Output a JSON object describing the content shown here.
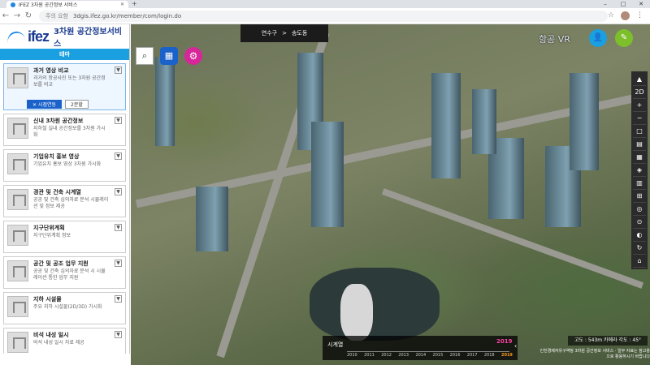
{
  "browser": {
    "tab_title": "IFEZ 3차원 공간정보 서비스",
    "url_security": "주의 요함",
    "url": "3dgis.ifez.go.kr/member/com/login.do"
  },
  "sidebar": {
    "logo": "ifez",
    "logo_sub": "3차원 공간정보서비스",
    "theme_label": "테마",
    "items": [
      {
        "title": "과거 영상 비교",
        "desc": "과거의 항공사진 또는 3차원 공간정보를 비교",
        "active": true,
        "btn_compare": "✕ 시점연동",
        "btn_toggle": "2분할"
      },
      {
        "title": "신내 3차원 공간정보",
        "desc": "지하철 실내 공간정보를 3차원 가시화"
      },
      {
        "title": "기업유치 홍보 영상",
        "desc": "기업유치 홍보 영상 3차원 가시화"
      },
      {
        "title": "경관 및 건축 시계열",
        "desc": "공공 및 건축 심의자료 분석 시뮬레이션 및 정보 제공"
      },
      {
        "title": "지구단위계획",
        "desc": "지구단위계획 정보"
      },
      {
        "title": "공간 및 공조 업무 지원",
        "desc": "공공 및 건축 심의자료 분석 시 시뮬레이션 통한 업무 지원"
      },
      {
        "title": "지하 시설물",
        "desc": "주요 지하 시설물(2D/3D) 가시화"
      },
      {
        "title": "비석 내성 일시",
        "desc": "비석 내성 일시 자료 제공"
      }
    ]
  },
  "map": {
    "location_district": "연수구",
    "location_sep": ">",
    "location_place": "송도동",
    "vr_label": "항공 VR",
    "tools": [
      "▲",
      "2D",
      "+",
      "−",
      "□",
      "▤",
      "▦",
      "◈",
      "▥",
      "⊞",
      "◎",
      "⊙",
      "◐",
      "↻",
      "⌂"
    ],
    "status": "고도 : 543m   카메라 각도 : 45°",
    "copyright": "인천경제자유구역청 3차원 공간정보 서비스 · 일부 자료는 참고용으로 활용하시기 바랍니다",
    "timeline": {
      "label": "시계열",
      "current": "2019",
      "years": [
        "2010",
        "2011",
        "2012",
        "2013",
        "2014",
        "2015",
        "2016",
        "2017",
        "2018",
        "2019"
      ],
      "selected": "2019"
    }
  },
  "colors": {
    "theme": "#1a9fe0",
    "logo": "#1a3a8f",
    "setting": "#d6269a",
    "edit": "#7cbf2a",
    "year_selected": "#ff9a1f"
  }
}
